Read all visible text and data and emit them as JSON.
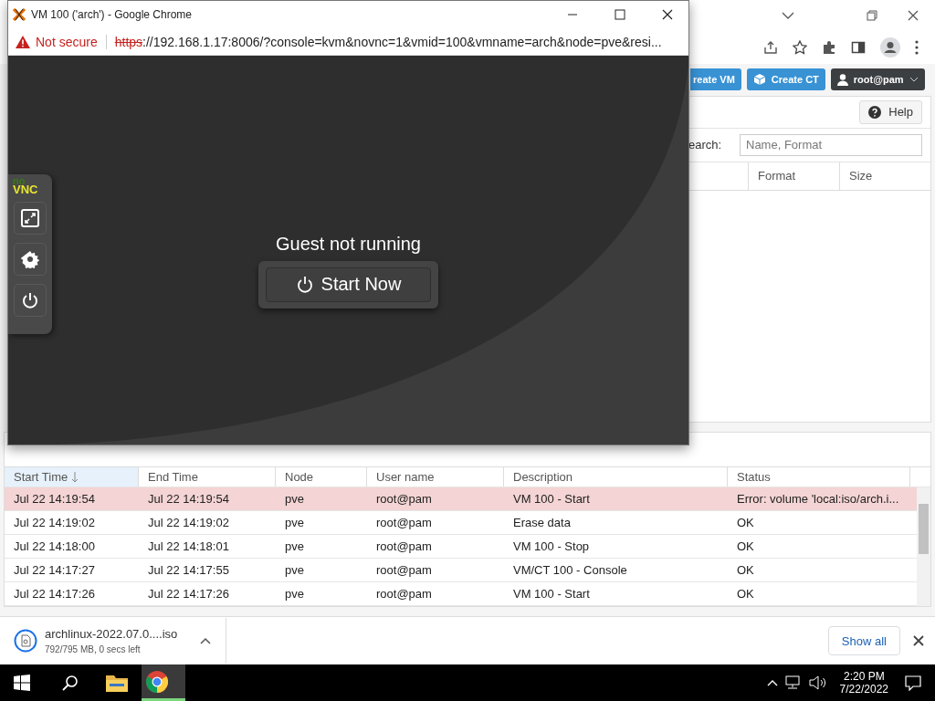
{
  "proxmox": {
    "header_buttons": [
      {
        "label": "reate VM",
        "kind": "vm"
      },
      {
        "label": "Create CT",
        "kind": "ct"
      }
    ],
    "user_menu": "root@pam",
    "help_button": "Help",
    "search": {
      "label": "earch:",
      "placeholder": "Name, Format"
    },
    "content_columns": [
      "Format",
      "Size"
    ]
  },
  "task_log": {
    "columns": [
      {
        "label": "Start Time",
        "sorted": true
      },
      {
        "label": "End Time",
        "sorted": false
      },
      {
        "label": "Node",
        "sorted": false
      },
      {
        "label": "User name",
        "sorted": false
      },
      {
        "label": "Description",
        "sorted": false
      },
      {
        "label": "Status",
        "sorted": false
      }
    ],
    "rows": [
      {
        "kind": "error",
        "cells": [
          "Jul 22 14:19:54",
          "Jul 22 14:19:54",
          "pve",
          "root@pam",
          "VM 100 - Start",
          "Error: volume 'local:iso/arch.i..."
        ]
      },
      {
        "kind": "ok",
        "cells": [
          "Jul 22 14:19:02",
          "Jul 22 14:19:02",
          "pve",
          "root@pam",
          "Erase data",
          "OK"
        ]
      },
      {
        "kind": "ok",
        "cells": [
          "Jul 22 14:18:00",
          "Jul 22 14:18:01",
          "pve",
          "root@pam",
          "VM 100 - Stop",
          "OK"
        ]
      },
      {
        "kind": "ok",
        "cells": [
          "Jul 22 14:17:27",
          "Jul 22 14:17:55",
          "pve",
          "root@pam",
          "VM/CT 100 - Console",
          "OK"
        ]
      },
      {
        "kind": "ok",
        "cells": [
          "Jul 22 14:17:26",
          "Jul 22 14:17:26",
          "pve",
          "root@pam",
          "VM 100 - Start",
          "OK"
        ]
      }
    ]
  },
  "download": {
    "file": "archlinux-2022.07.0....iso",
    "progress": "792/795 MB, 0 secs left",
    "show_all": "Show all"
  },
  "taskbar": {
    "time": "2:20 PM",
    "date": "7/22/2022"
  },
  "popup": {
    "title": "VM 100 ('arch') - Google Chrome",
    "security": "Not secure",
    "url_scheme": "https",
    "url_rest": "://192.168.1.17:8006/?console=kvm&novnc=1&vmid=100&vmname=arch&node=pve&resi...",
    "logo_top": "no",
    "logo_bottom": "VNC",
    "message": "Guest not running",
    "start_button": "Start Now"
  }
}
